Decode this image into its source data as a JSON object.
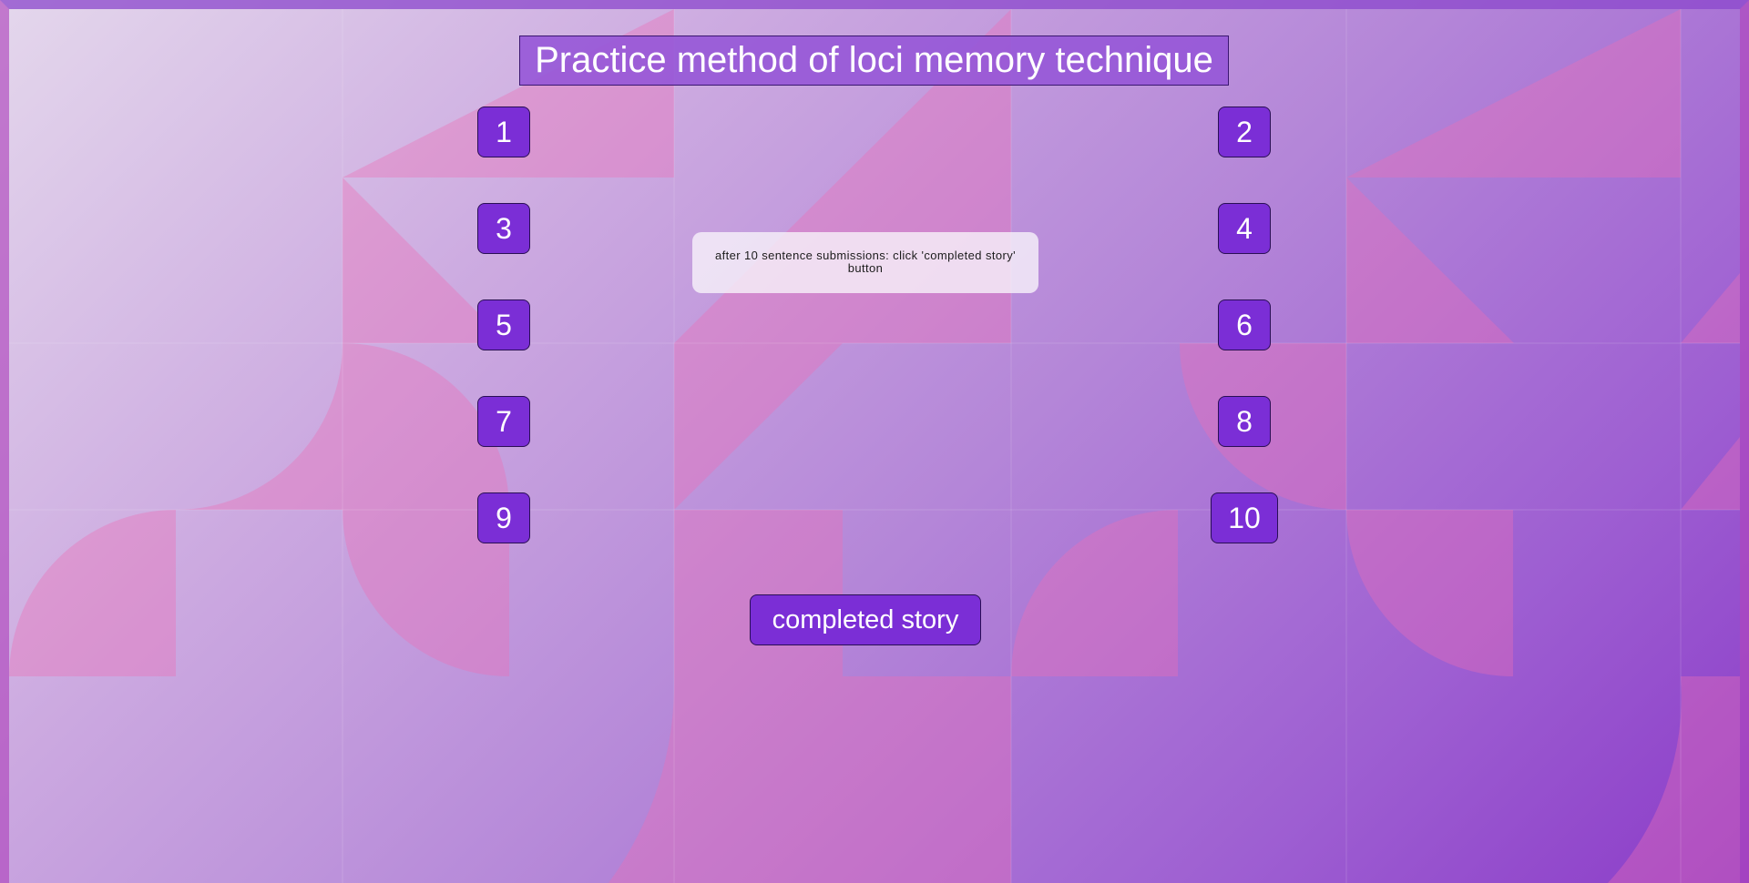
{
  "title": "Practice method of loci memory technique",
  "loci_buttons": {
    "b1": "1",
    "b2": "2",
    "b3": "3",
    "b4": "4",
    "b5": "5",
    "b6": "6",
    "b7": "7",
    "b8": "8",
    "b9": "9",
    "b10": "10"
  },
  "instruction": "after 10 sentence submissions: click 'completed story' button",
  "completed_button": "completed story",
  "colors": {
    "button_fill": "#7b2ed6",
    "title_fill": "#9656d7",
    "background_light": "#e4d7ec",
    "background_dark": "#8b3cc8",
    "pattern_pink": "#e879b8"
  }
}
